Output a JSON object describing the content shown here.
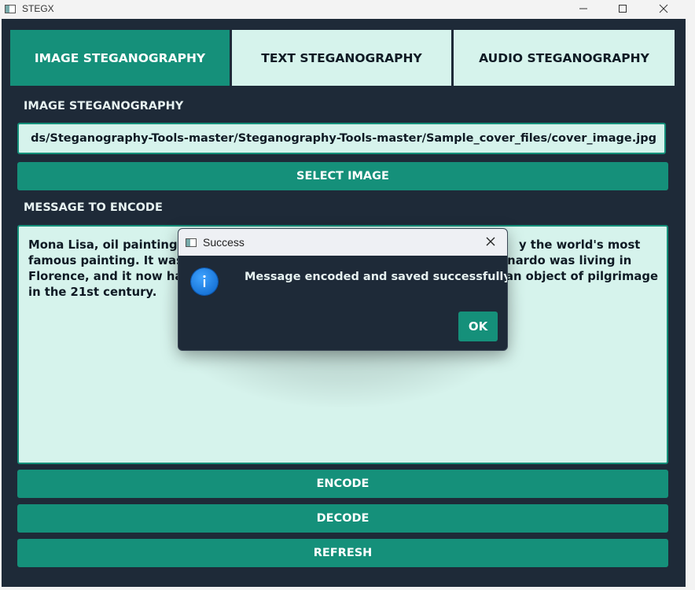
{
  "window": {
    "title": "STEGX"
  },
  "tabs": [
    {
      "label": "IMAGE STEGANOGRAPHY",
      "active": true
    },
    {
      "label": "TEXT STEGANOGRAPHY",
      "active": false
    },
    {
      "label": "AUDIO STEGANOGRAPHY",
      "active": false
    }
  ],
  "image_panel": {
    "section_title": "IMAGE STEGANOGRAPHY",
    "file_path": "ds/Steganography-Tools-master/Steganography-Tools-master/Sample_cover_files/cover_image.jpg",
    "select_button": "SELECT IMAGE",
    "message_label": "MESSAGE TO ENCODE",
    "message_lines": [
      "Mona Lisa, oil painting o",
      "famous painting. It was",
      "Florence, and it now ha",
      "in the 21st century.",
      "y the world's most",
      "onardo was living in",
      "an object of pilgrimage"
    ],
    "encode_button": "ENCODE",
    "decode_button": "DECODE",
    "refresh_button": "REFRESH"
  },
  "dialog": {
    "title": "Success",
    "message": "Message encoded and saved successfully!",
    "ok_button": "OK",
    "icon": "info-icon"
  },
  "colors": {
    "accent": "#15907a",
    "panel_bg": "#1e2a38",
    "field_bg": "#d6f3ec"
  }
}
